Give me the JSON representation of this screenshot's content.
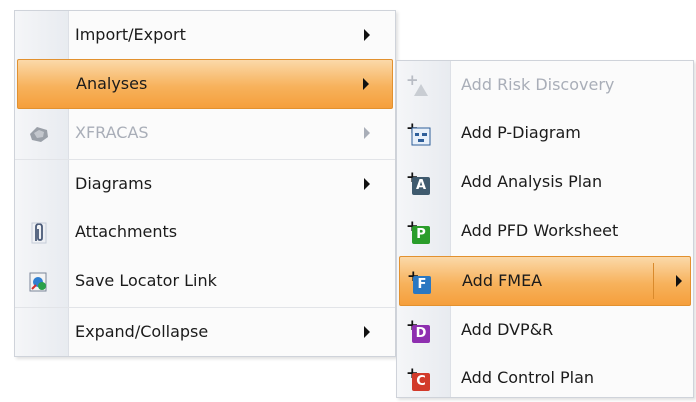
{
  "main_menu": {
    "items": [
      {
        "label": "Import/Export",
        "icon": "none",
        "has_submenu": true,
        "enabled": true
      },
      {
        "label": "Analyses",
        "icon": "none",
        "has_submenu": true,
        "enabled": true,
        "highlighted": true
      },
      {
        "label": "XFRACAS",
        "icon": "xfracas-icon",
        "has_submenu": true,
        "enabled": false
      },
      {
        "label": "Diagrams",
        "icon": "none",
        "has_submenu": true,
        "enabled": true
      },
      {
        "label": "Attachments",
        "icon": "paperclip-icon",
        "has_submenu": false,
        "enabled": true
      },
      {
        "label": "Save Locator Link",
        "icon": "locator-link-icon",
        "has_submenu": false,
        "enabled": true
      },
      {
        "label": "Expand/Collapse",
        "icon": "none",
        "has_submenu": true,
        "enabled": true
      }
    ]
  },
  "sub_menu": {
    "items": [
      {
        "label": "Add Risk Discovery",
        "icon": "add-risk-discovery-icon",
        "enabled": false
      },
      {
        "label": "Add P-Diagram",
        "icon": "add-p-diagram-icon",
        "enabled": true
      },
      {
        "label": "Add Analysis Plan",
        "icon": "add-analysis-plan-icon",
        "letter": "A",
        "color": "#3f5a6e",
        "enabled": true
      },
      {
        "label": "Add PFD Worksheet",
        "icon": "add-pfd-worksheet-icon",
        "letter": "P",
        "color": "#2a9d2a",
        "enabled": true
      },
      {
        "label": "Add FMEA",
        "icon": "add-fmea-icon",
        "letter": "F",
        "color": "#2b78c2",
        "enabled": true,
        "highlighted": true,
        "has_submenu": true
      },
      {
        "label": "Add DVP&R",
        "icon": "add-dvpr-icon",
        "letter": "D",
        "color": "#8e2fb0",
        "enabled": true
      },
      {
        "label": "Add Control Plan",
        "icon": "add-control-plan-icon",
        "letter": "C",
        "color": "#d23a2a",
        "enabled": true
      }
    ]
  },
  "colors": {
    "highlight_top": "#fbd9a9",
    "highlight_bottom": "#f59f3c",
    "disabled_text": "#a9aeb8"
  }
}
